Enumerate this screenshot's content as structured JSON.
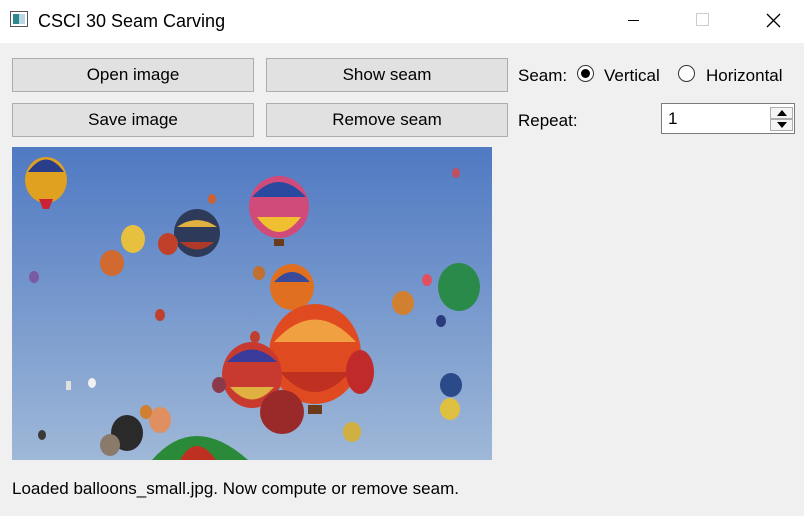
{
  "window": {
    "title": "CSCI 30 Seam Carving"
  },
  "buttons": {
    "open": "Open image",
    "show_seam": "Show seam",
    "save": "Save image",
    "remove_seam": "Remove seam"
  },
  "seam": {
    "label": "Seam:",
    "options": [
      "Vertical",
      "Horizontal"
    ],
    "selected": "Vertical"
  },
  "repeat": {
    "label": "Repeat:",
    "value": "1"
  },
  "image": {
    "subject": "hot air balloons in blue sky"
  },
  "status": "Loaded balloons_small.jpg. Now compute or remove seam.",
  "colors": {
    "sky_top": "#4f79c2",
    "sky_bottom": "#9fb8d8",
    "button_bg": "#e1e1e1",
    "window_bg": "#f0f0f0"
  }
}
